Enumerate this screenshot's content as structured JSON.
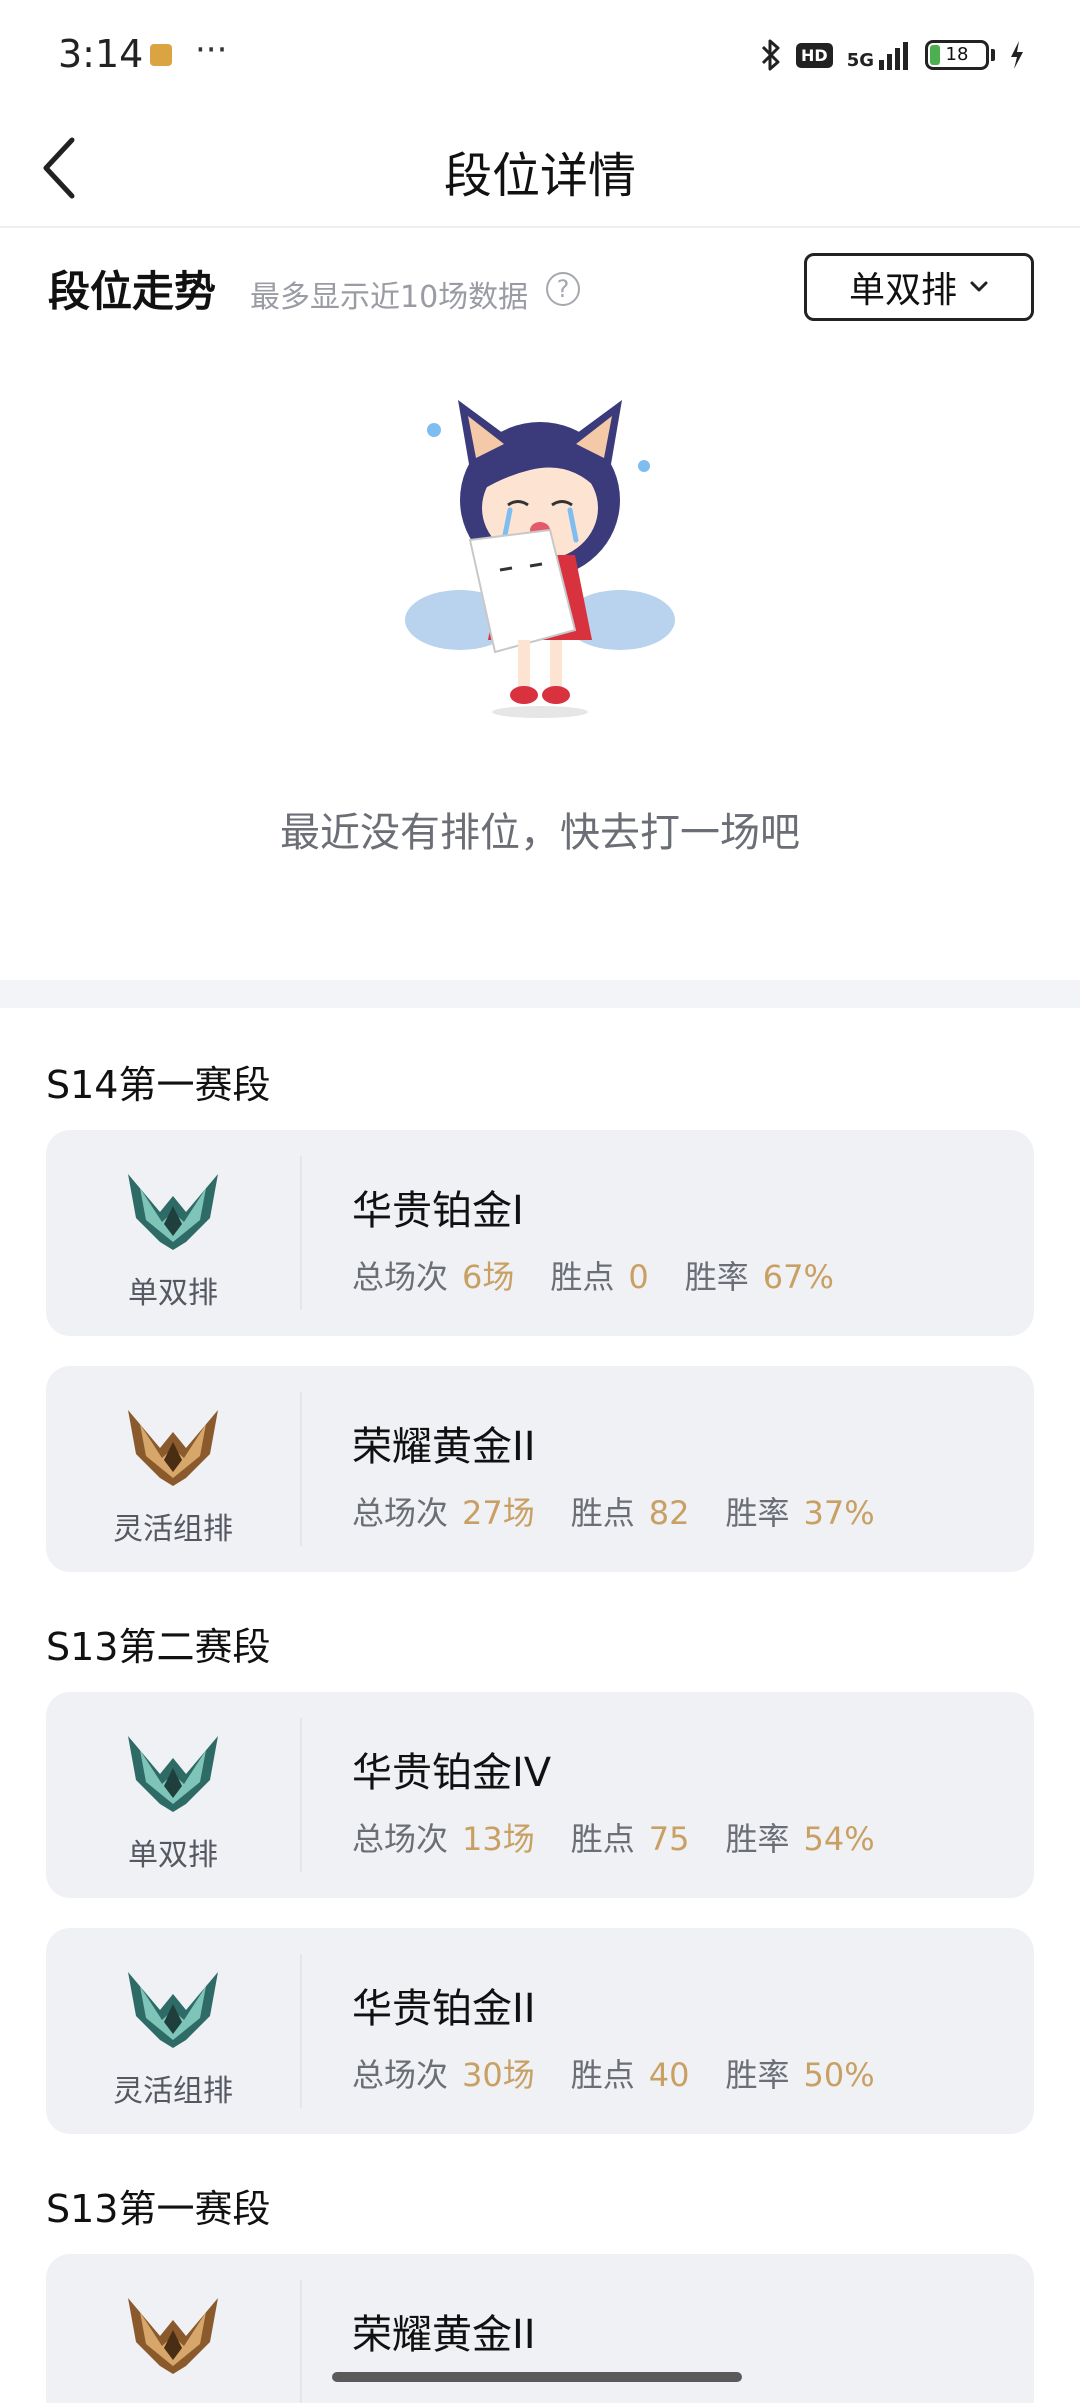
{
  "status_bar": {
    "time": "3:14",
    "menu_dots": "···",
    "hd_label": "HD",
    "network_label": "5G",
    "battery_level": "18",
    "battery_fraction": 0.18
  },
  "header": {
    "title": "段位详情"
  },
  "trend": {
    "title": "段位走势",
    "subtitle": "最多显示近10场数据",
    "help_symbol": "?",
    "queue_select": "单双排",
    "empty_text": "最近没有排位，快去打一场吧"
  },
  "seasons": [
    {
      "title": "S14第一赛段",
      "cards": [
        {
          "emblem": "platinum-emblem",
          "queue": "单双排",
          "rank": "华贵铂金I",
          "games_label": "总场次",
          "games": "6场",
          "lp_label": "胜点",
          "lp": "0",
          "winrate_label": "胜率",
          "winrate": "67%"
        },
        {
          "emblem": "gold-emblem",
          "queue": "灵活组排",
          "rank": "荣耀黄金II",
          "games_label": "总场次",
          "games": "27场",
          "lp_label": "胜点",
          "lp": "82",
          "winrate_label": "胜率",
          "winrate": "37%"
        }
      ]
    },
    {
      "title": "S13第二赛段",
      "cards": [
        {
          "emblem": "platinum-emblem",
          "queue": "单双排",
          "rank": "华贵铂金IV",
          "games_label": "总场次",
          "games": "13场",
          "lp_label": "胜点",
          "lp": "75",
          "winrate_label": "胜率",
          "winrate": "54%"
        },
        {
          "emblem": "platinum-emblem",
          "queue": "灵活组排",
          "rank": "华贵铂金II",
          "games_label": "总场次",
          "games": "30场",
          "lp_label": "胜点",
          "lp": "40",
          "winrate_label": "胜率",
          "winrate": "50%"
        }
      ]
    },
    {
      "title": "S13第一赛段",
      "cards": [
        {
          "emblem": "gold-emblem",
          "rank": "荣耀黄金II"
        }
      ]
    }
  ],
  "colors": {
    "accent_value": "#c9a063",
    "card_background": "#eff1f5",
    "platinum": "#2e6b66",
    "gold": "#8a5a2c"
  }
}
